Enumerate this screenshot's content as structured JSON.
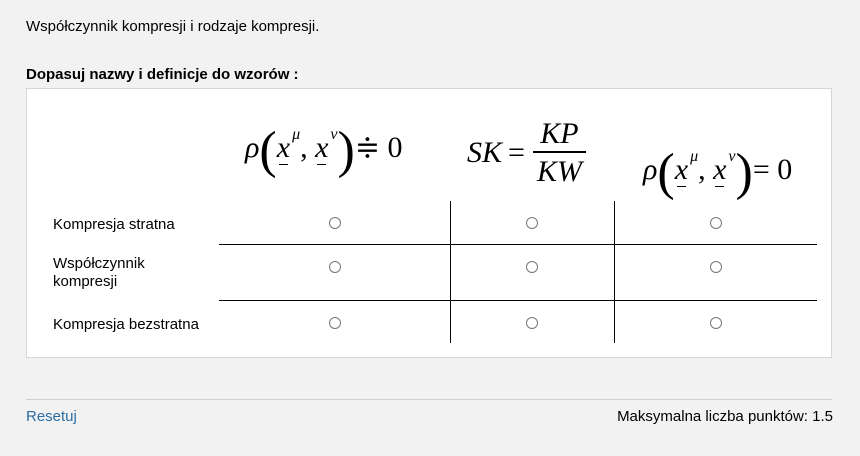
{
  "question": {
    "title": "Współczynnik  kompresji i rodzaje kompresji.",
    "instruction": "Dopasuj nazwy i definicje do wzorów :"
  },
  "formulas": [
    {
      "id": "f1",
      "rho": "ρ",
      "x": "x",
      "mu": "μ",
      "comma": ",",
      "nu": "ν",
      "relation": "≑",
      "rhs": "0"
    },
    {
      "id": "f2",
      "lhs": "SK",
      "equals": "=",
      "numerator": "KP",
      "denominator": "KW"
    },
    {
      "id": "f3",
      "rho": "ρ",
      "x": "x",
      "mu": "μ",
      "comma": ",",
      "nu": "ν",
      "relation": "=",
      "rhs": "0"
    }
  ],
  "rows": [
    {
      "label": "Kompresja stratna"
    },
    {
      "label": "Współczynnik kompresji"
    },
    {
      "label": "Kompresja bezstratna"
    }
  ],
  "footer": {
    "reset_label": "Resetuj",
    "max_points": "Maksymalna liczba punktów: 1.5"
  }
}
